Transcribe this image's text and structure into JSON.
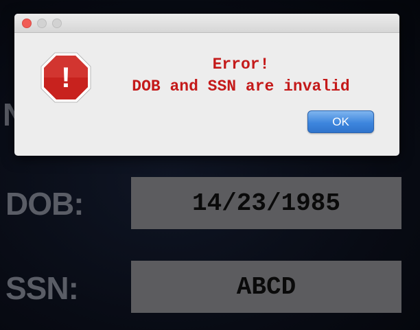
{
  "background": {
    "partial_label": "N",
    "dob_label": "DOB:",
    "dob_value": "14/23/1985",
    "ssn_label": "SSN:",
    "ssn_value": "ABCD"
  },
  "dialog": {
    "title_line": "Error!",
    "message_line": "DOB and SSN are invalid",
    "ok_label": "OK",
    "icon": "stop-alert-icon",
    "icon_glyph": "!"
  },
  "colors": {
    "message_text": "#c41a1a",
    "stop_sign": "#c8221e",
    "ok_button": "#3e86de",
    "field_bg": "#5c5c5f"
  }
}
